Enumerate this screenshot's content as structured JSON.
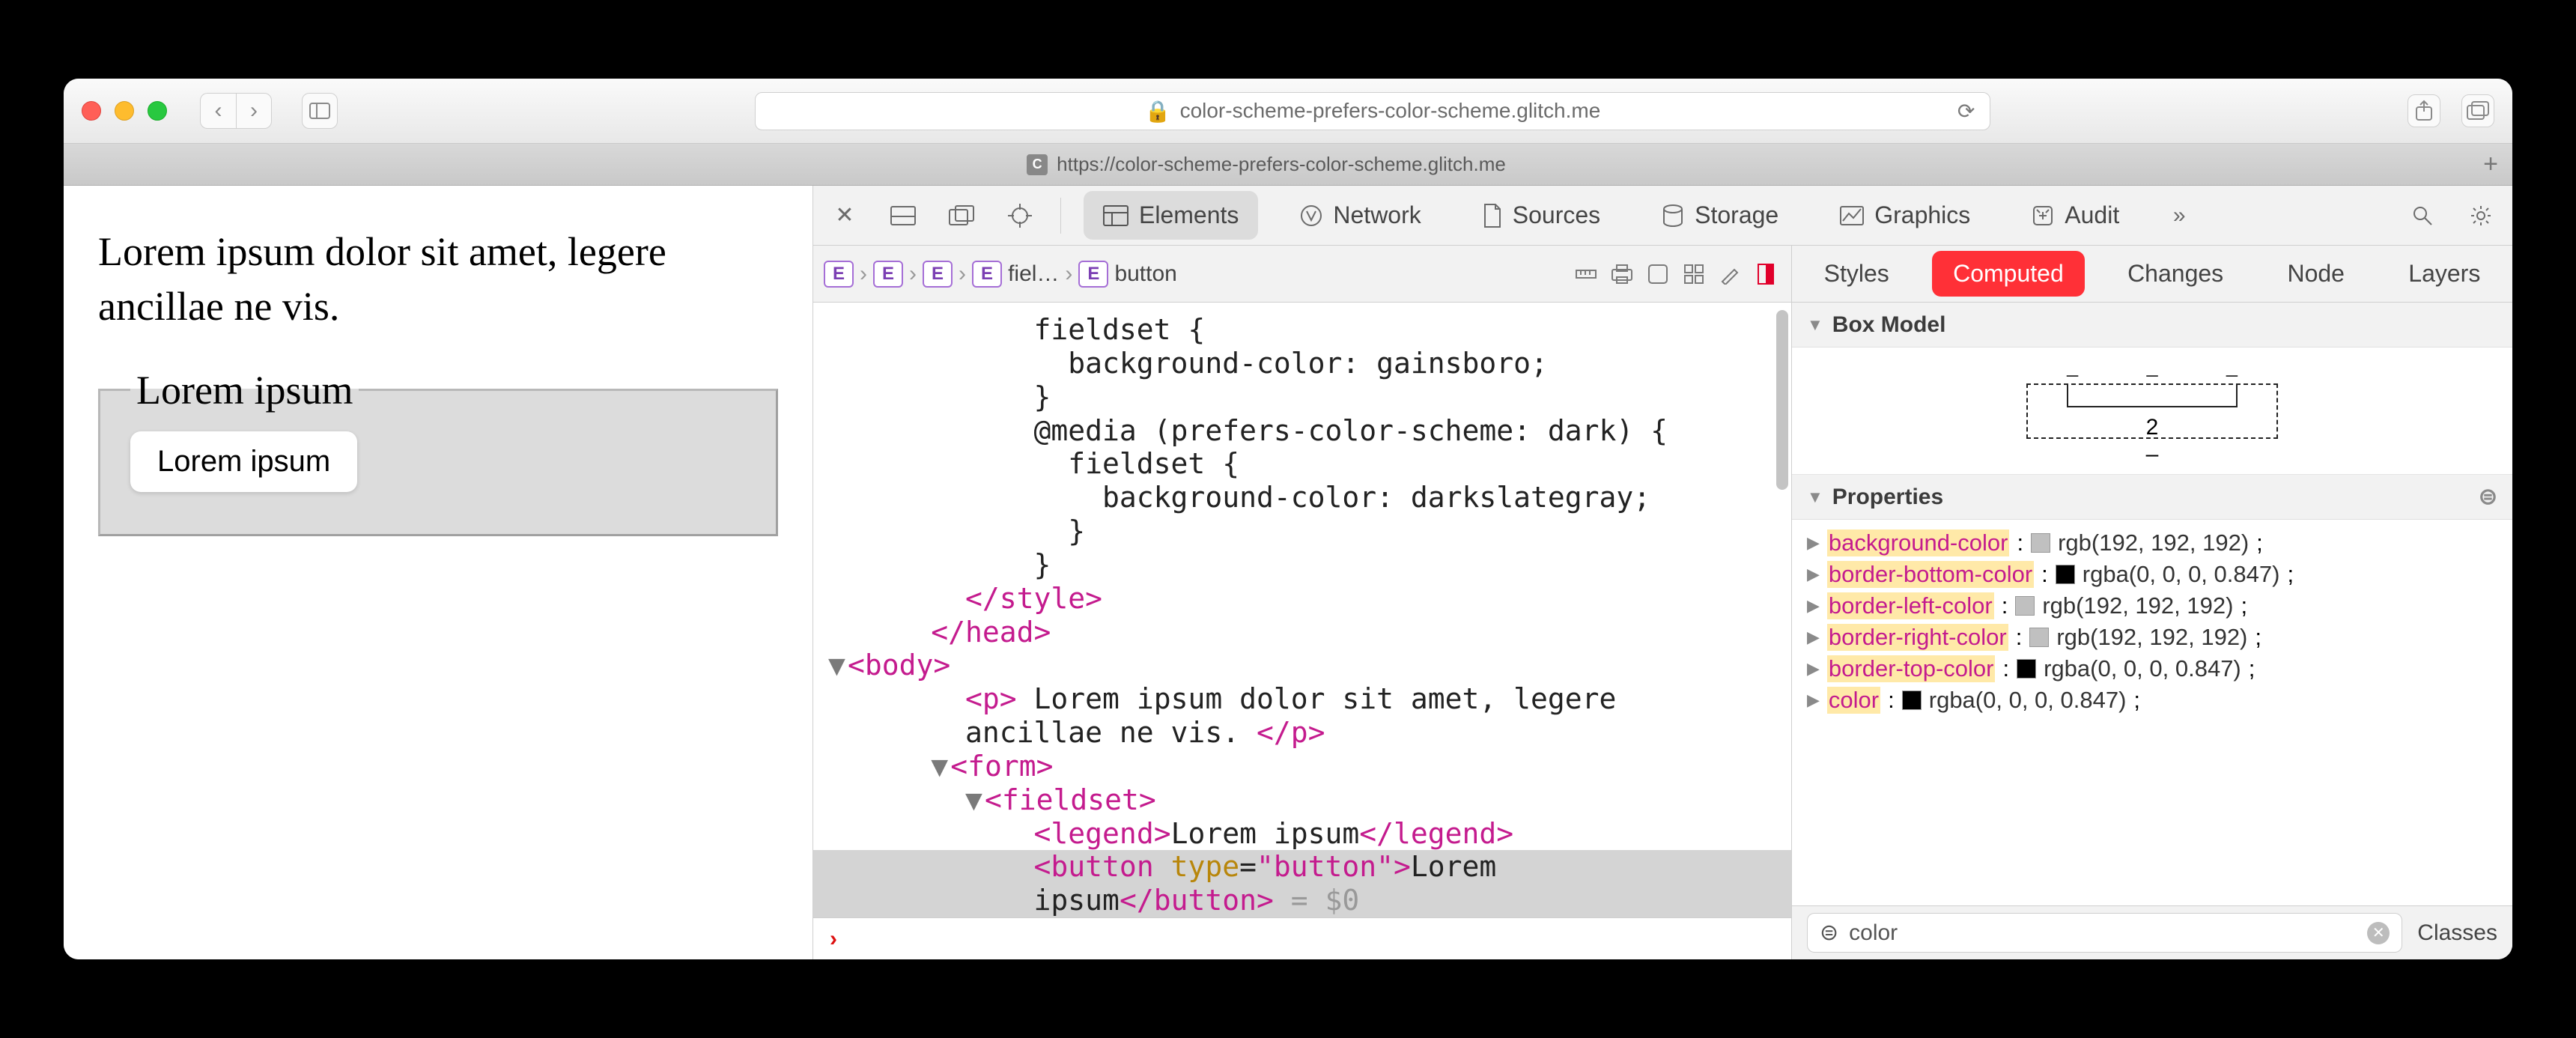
{
  "window": {
    "url_host": "color-scheme-prefers-color-scheme.glitch.me",
    "lock_prefix": "🔒",
    "tab_url": "https://color-scheme-prefers-color-scheme.glitch.me",
    "tab_favicon_letter": "C"
  },
  "page": {
    "paragraph": "Lorem ipsum dolor sit amet, legere ancillae ne vis.",
    "legend": "Lorem ipsum",
    "button": "Lorem ipsum"
  },
  "devtools": {
    "tabs": {
      "elements": "Elements",
      "network": "Network",
      "sources": "Sources",
      "storage": "Storage",
      "graphics": "Graphics",
      "audit": "Audit"
    },
    "breadcrumbs": {
      "items": [
        "E",
        "E",
        "E",
        "E",
        "E"
      ],
      "fiel": "fiel…",
      "button": "button"
    },
    "dom_lines": [
      "            fieldset {",
      "              background-color: gainsboro;",
      "            }",
      "            @media (prefers-color-scheme: dark) {",
      "              fieldset {",
      "                background-color: darkslategray;",
      "              }",
      "            }",
      "        </style>",
      "      </head>",
      "    ▼ <body>",
      "        <p> Lorem ipsum dolor sit amet, legere",
      "        ancillae ne vis. </p>",
      "      ▼ <form>",
      "        ▼ <fieldset>",
      "            <legend>Lorem ipsum</legend>",
      "            <button type=\"button\">Lorem",
      "            ipsum</button> = $0"
    ],
    "styles_tabs": {
      "styles": "Styles",
      "computed": "Computed",
      "changes": "Changes",
      "node": "Node",
      "layers": "Layers"
    },
    "box_model_label": "Box Model",
    "box_model_value": "2",
    "properties_label": "Properties",
    "properties": [
      {
        "name": "background-color",
        "swatch": "#c0c0c0",
        "value": "rgb(192, 192, 192)"
      },
      {
        "name": "border-bottom-color",
        "swatch": "#000000",
        "value": "rgba(0, 0, 0, 0.847)"
      },
      {
        "name": "border-left-color",
        "swatch": "#c0c0c0",
        "value": "rgb(192, 192, 192)"
      },
      {
        "name": "border-right-color",
        "swatch": "#c0c0c0",
        "value": "rgb(192, 192, 192)"
      },
      {
        "name": "border-top-color",
        "swatch": "#000000",
        "value": "rgba(0, 0, 0, 0.847)"
      },
      {
        "name": "color",
        "swatch": "#000000",
        "value": "rgba(0, 0, 0, 0.847)"
      }
    ],
    "filter_value": "color",
    "classes_button": "Classes"
  }
}
